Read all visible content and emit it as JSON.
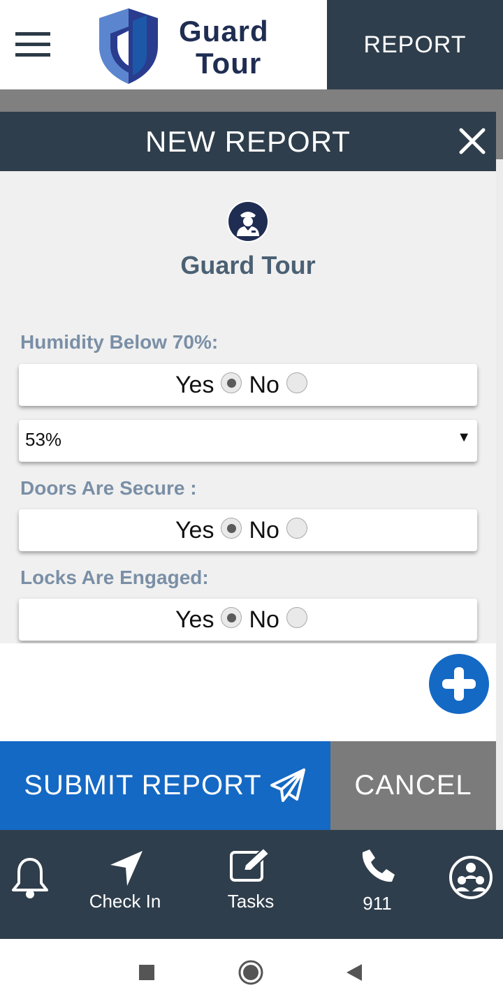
{
  "header": {
    "logo_line1": "Guard",
    "logo_line2": "Tour",
    "report_tab": "REPORT"
  },
  "modal": {
    "title": "NEW REPORT",
    "brand_name": "Guard Tour",
    "fields": [
      {
        "label": "Humidity Below 70%:",
        "yes": "Yes",
        "no": "No",
        "selected": "Yes"
      },
      {
        "label": "Doors Are Secure :",
        "yes": "Yes",
        "no": "No",
        "selected": "Yes"
      },
      {
        "label": "Locks Are Engaged:",
        "yes": "Yes",
        "no": "No",
        "selected": "Yes"
      }
    ],
    "humidity_select": {
      "value": "53%",
      "arrow": "▼"
    }
  },
  "actions": {
    "submit": "SUBMIT REPORT",
    "cancel": "CANCEL"
  },
  "bottom_nav": {
    "items": [
      {
        "icon": "bell-icon",
        "label": ""
      },
      {
        "icon": "navigation-arrow-icon",
        "label": "Check In"
      },
      {
        "icon": "edit-icon",
        "label": "Tasks"
      },
      {
        "icon": "phone-icon",
        "label": "911"
      },
      {
        "icon": "group-icon",
        "label": ""
      }
    ]
  },
  "colors": {
    "dark_navy": "#2f3e4c",
    "primary_blue": "#1469c4",
    "cancel_gray": "#7b7b7b",
    "label_blue_gray": "#7a8fa6",
    "brand_navy": "#1f2d52"
  }
}
